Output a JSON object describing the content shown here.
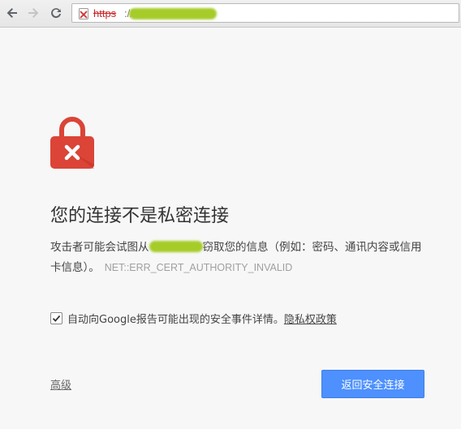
{
  "browser": {
    "url_scheme": "https",
    "url_separator": "://",
    "cert_status": "invalid",
    "nav": {
      "back_icon": "arrow-left-icon",
      "forward_icon": "arrow-right-icon",
      "reload_icon": "reload-icon"
    }
  },
  "interstitial": {
    "icon": "lock-error-icon",
    "heading": "您的连接不是私密连接",
    "explanation_part1": "攻击者可能会试图从",
    "explanation_part2": "窃取您的信息（例如：密码、通讯内容或信用卡信息）。",
    "error_code": "NET::ERR_CERT_AUTHORITY_INVALID",
    "report": {
      "checked": true,
      "label": "自动向Google报告可能出现的安全事件详情。",
      "link": "隐私权政策"
    },
    "advanced_link": "高级",
    "back_button": "返回安全连接"
  },
  "colors": {
    "lock_red": "#db4437",
    "button_blue": "#4d90fe",
    "scheme_red": "#c62828",
    "redaction_green": "#a6cc2a"
  }
}
